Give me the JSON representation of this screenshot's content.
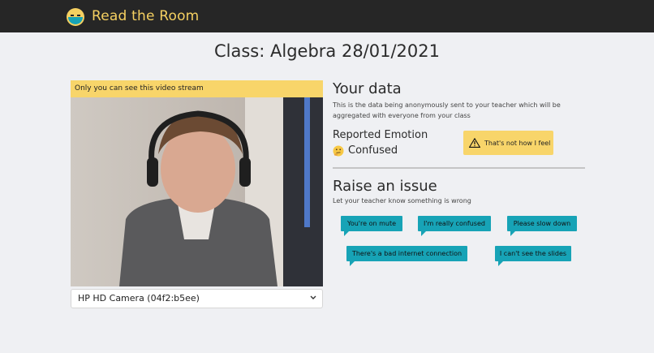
{
  "app": {
    "brand": "Read the Room",
    "accent": "#f5d061",
    "navbar_color": "#262626"
  },
  "page": {
    "title": "Class: Algebra 28/01/2021"
  },
  "video": {
    "banner": "Only you can see this video stream",
    "camera_selected": "HP HD Camera (04f2:b5ee)"
  },
  "your_data": {
    "heading": "Your data",
    "description": "This is the data being anonymously sent to your teacher which will be aggregated with everyone from your class",
    "emotion_label": "Reported Emotion",
    "emotion_icon": "thinking-face-emoji",
    "emotion_value": "Confused",
    "disagree_button": "That's not how I feel"
  },
  "issues": {
    "heading": "Raise an issue",
    "description": "Let your teacher know something is wrong",
    "buttons": [
      "You're on mute",
      "I'm really confused",
      "Please slow down",
      "There's a bad internet connection",
      "I can't see the slides"
    ],
    "button_color": "#17a3b6"
  }
}
